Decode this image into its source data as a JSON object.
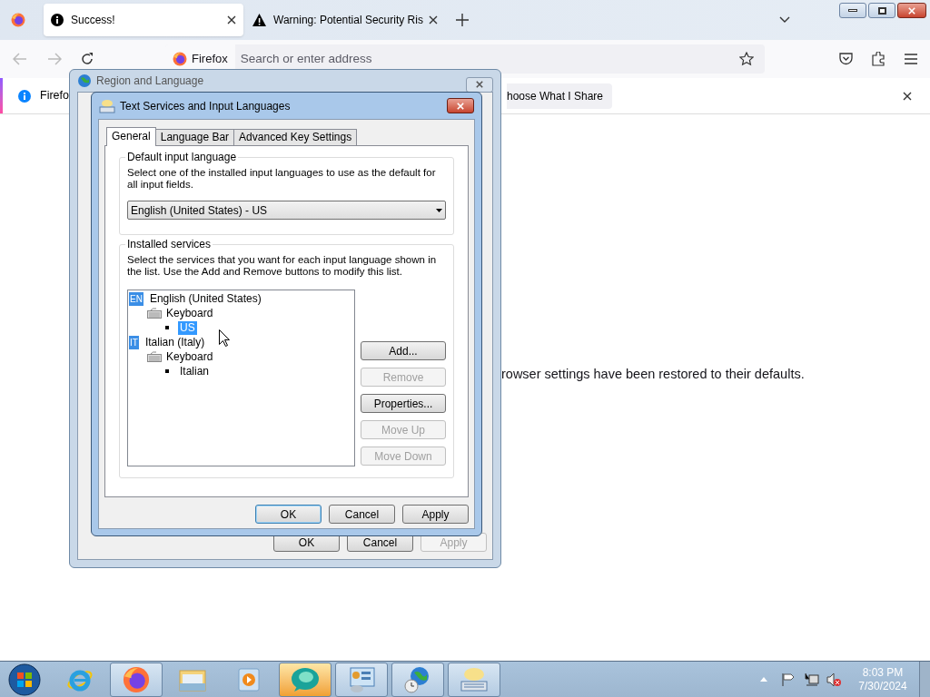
{
  "browser": {
    "tabs": [
      {
        "title": "Success!",
        "selected": true
      },
      {
        "title": "Warning: Potential Security Ris",
        "selected": false
      }
    ],
    "urlbar": {
      "identity": "Firefox",
      "placeholder": "Search or enter address"
    },
    "notification": {
      "text": "Firefo",
      "button": "hoose What I Share"
    },
    "page": {
      "message": "rowser settings have been restored to their defaults."
    }
  },
  "region_dialog": {
    "title": "Region and Language",
    "active": false,
    "buttons": [
      {
        "label": "OK",
        "disabled": false,
        "default": false
      },
      {
        "label": "Cancel",
        "disabled": false,
        "default": false
      },
      {
        "label": "Apply",
        "disabled": true,
        "default": false
      }
    ]
  },
  "text_services_dialog": {
    "title": "Text Services and Input Languages",
    "active": true,
    "tabs": [
      {
        "label": "General",
        "selected": true
      },
      {
        "label": "Language Bar",
        "selected": false
      },
      {
        "label": "Advanced Key Settings",
        "selected": false
      }
    ],
    "default_group": {
      "legend": "Default input language",
      "description": "Select one of the installed input languages to use as the default for all input fields.",
      "value": "English (United States) - US"
    },
    "services_group": {
      "legend": "Installed services",
      "description": "Select the services that you want for each input language shown in the list. Use the Add and Remove buttons to modify this list.",
      "tree": [
        {
          "badge": "EN",
          "label": "English (United States)",
          "selected": false,
          "children": [
            {
              "label": "Keyboard",
              "selected": false,
              "children": [
                {
                  "label": "US",
                  "selected": true
                }
              ]
            }
          ]
        },
        {
          "badge": "IT",
          "label": "Italian (Italy)",
          "selected": false,
          "children": [
            {
              "label": "Keyboard",
              "selected": false,
              "children": [
                {
                  "label": "Italian",
                  "selected": false
                }
              ]
            }
          ]
        }
      ],
      "side_buttons": [
        {
          "label": "Add...",
          "disabled": false
        },
        {
          "label": "Remove",
          "disabled": true
        },
        {
          "label": "Properties...",
          "disabled": false
        },
        {
          "label": "Move Up",
          "disabled": true
        },
        {
          "label": "Move Down",
          "disabled": true
        }
      ]
    },
    "buttons": [
      {
        "label": "OK",
        "disabled": false,
        "default": true
      },
      {
        "label": "Cancel",
        "disabled": false,
        "default": false
      },
      {
        "label": "Apply",
        "disabled": false,
        "default": false
      }
    ]
  },
  "taskbar": {
    "items": [
      {
        "kind": "ie",
        "open": false,
        "active": false
      },
      {
        "kind": "firefox",
        "open": true,
        "active": false
      },
      {
        "kind": "explorer",
        "open": false,
        "active": false
      },
      {
        "kind": "media",
        "open": false,
        "active": false
      },
      {
        "kind": "app",
        "open": true,
        "active": true
      },
      {
        "kind": "control-panel",
        "open": true,
        "active": false
      },
      {
        "kind": "globe",
        "open": true,
        "active": false
      },
      {
        "kind": "keyboard",
        "open": true,
        "active": false
      }
    ],
    "clock": {
      "time": "8:03 PM",
      "date": "7/30/2024"
    }
  }
}
